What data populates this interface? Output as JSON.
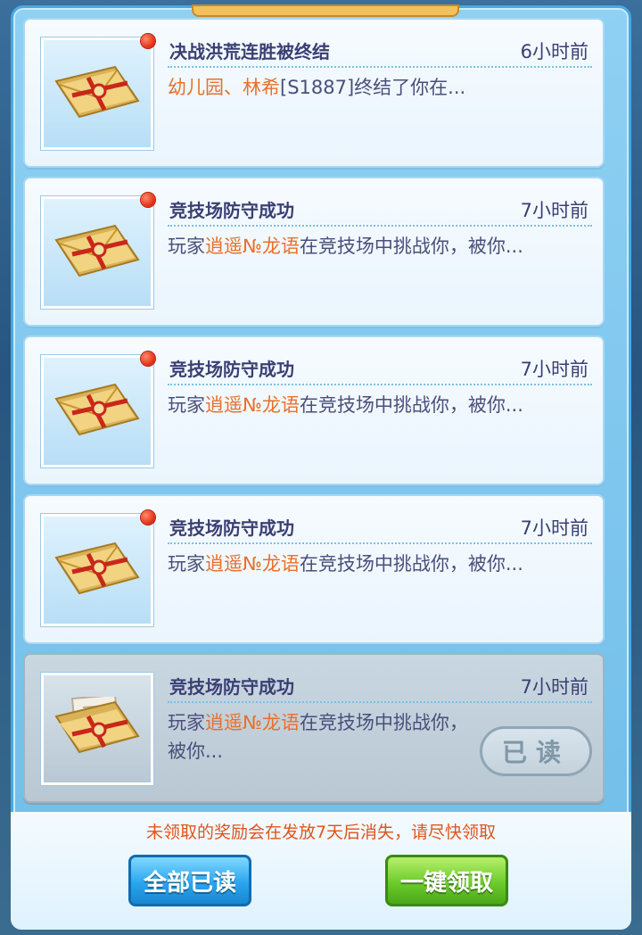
{
  "mails": [
    {
      "title": "决战洪荒连胜被终结",
      "time": "6小时前",
      "preview_pre": "",
      "preview_hl": "幼儿园、林希",
      "preview_post": "[S1887]终结了你在...",
      "unread": true
    },
    {
      "title": "竞技场防守成功",
      "time": "7小时前",
      "preview_pre": "玩家",
      "preview_hl": "逍遥№龙语",
      "preview_post": "在竞技场中挑战你，被你...",
      "unread": true
    },
    {
      "title": "竞技场防守成功",
      "time": "7小时前",
      "preview_pre": "玩家",
      "preview_hl": "逍遥№龙语",
      "preview_post": "在竞技场中挑战你，被你...",
      "unread": true
    },
    {
      "title": "竞技场防守成功",
      "time": "7小时前",
      "preview_pre": "玩家",
      "preview_hl": "逍遥№龙语",
      "preview_post": "在竞技场中挑战你，被你...",
      "unread": true
    },
    {
      "title": "竞技场防守成功",
      "time": "7小时前",
      "preview_pre": "玩家",
      "preview_hl": "逍遥№龙语",
      "preview_post": "在竞技场中挑战你，被你...",
      "unread": false,
      "read_label": "已读"
    }
  ],
  "footer": {
    "notice": "未领取的奖励会在发放7天后消失，请尽快领取",
    "read_all_label": "全部已读",
    "claim_all_label": "一键领取"
  },
  "colors": {
    "highlight": "#e8702c",
    "title": "#3a3f73",
    "unread_dot": "#e02a12"
  },
  "icons": {
    "mail": "envelope-icon",
    "opened_mail": "opened-envelope-icon",
    "unread": "unread-dot-icon"
  }
}
